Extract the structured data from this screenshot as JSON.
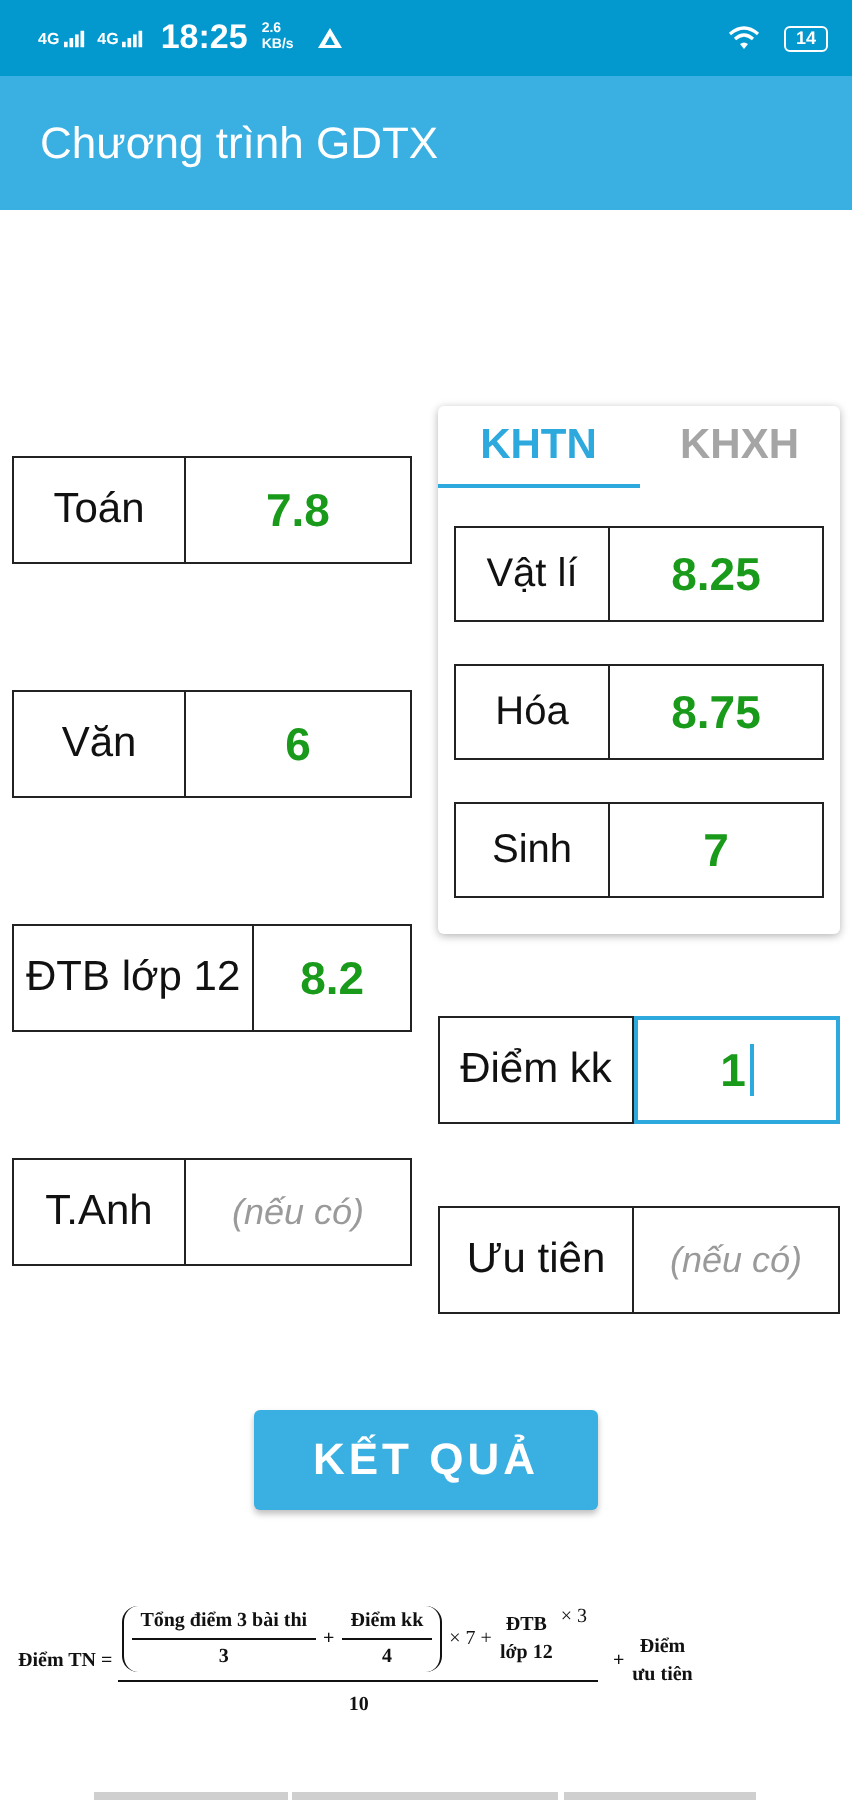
{
  "status_bar": {
    "signal_1": "4G",
    "signal_2": "4G",
    "time": "18:25",
    "speed_value": "2.6",
    "speed_unit": "KB/s",
    "battery": "14"
  },
  "app_bar": {
    "title": "Chương trình GDTX"
  },
  "left_fields": [
    {
      "label": "Toán",
      "value": "7.8"
    },
    {
      "label": "Văn",
      "value": "6"
    },
    {
      "label": "ĐTB lớp 12",
      "value": "8.2"
    },
    {
      "label": "T.Anh",
      "placeholder": "(nếu có)"
    }
  ],
  "tabs": [
    {
      "label": "KHTN",
      "selected": true
    },
    {
      "label": "KHXH",
      "selected": false
    }
  ],
  "tab_fields": [
    {
      "label": "Vật lí",
      "value": "8.25"
    },
    {
      "label": "Hóa",
      "value": "8.75"
    },
    {
      "label": "Sinh",
      "value": "7"
    }
  ],
  "right_fields": [
    {
      "label": "Điểm kk",
      "value": "1",
      "focused": true
    },
    {
      "label": "Ưu tiên",
      "placeholder": "(nếu có)",
      "focused": false
    }
  ],
  "result_button": "KẾT QUẢ",
  "formula": {
    "lhs": "Điểm TN =",
    "term1_num": "Tổng điểm 3 bài thi",
    "term1_den": "3",
    "plus_1": "+",
    "term2_num": "Điểm kk",
    "term2_den": "4",
    "times_7": "× 7 +",
    "term3_top": "ĐTB",
    "term3_bottom": "lớp 12",
    "times_3": "× 3",
    "denominator": "10",
    "plus_2": "+",
    "bonus_top": "Điểm",
    "bonus_bottom": "ưu tiên"
  }
}
